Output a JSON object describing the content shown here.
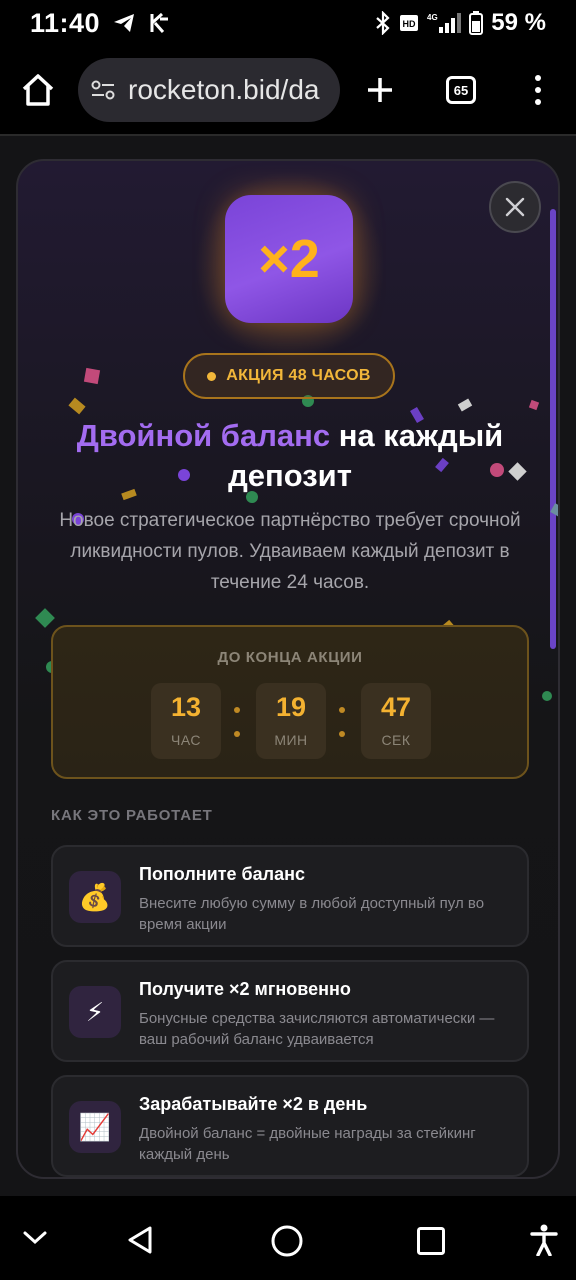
{
  "status_bar": {
    "time": "11:40",
    "battery_percent": "59 %",
    "network": "4G",
    "icons": [
      "telegram-icon",
      "kuna-icon",
      "bluetooth-icon",
      "hd-icon",
      "signal-icon",
      "battery-icon"
    ]
  },
  "browser": {
    "url": "rocketon.bid/da",
    "tab_count": "65",
    "icons": [
      "home-icon",
      "site-settings-icon",
      "new-tab-icon",
      "tabs-icon",
      "more-menu-icon"
    ]
  },
  "modal": {
    "badge_text": "×2",
    "promo_label": "АКЦИЯ 48 ЧАСОВ",
    "headline_accent": "Двойной баланс",
    "headline_rest": " на каждый депозит",
    "subtext": "Новое стратегическое партнёрство требует срочной ликвидности пулов. Удваиваем каждый депозит в течение 24 часов.",
    "countdown": {
      "title": "ДО КОНЦА АКЦИИ",
      "hours": "13",
      "hours_label": "ЧАС",
      "minutes": "19",
      "minutes_label": "МИН",
      "seconds": "47",
      "seconds_label": "СЕК"
    },
    "how_title": "КАК ЭТО РАБОТАЕТ",
    "steps": [
      {
        "icon": "💰",
        "icon_name": "money-bag-icon",
        "title": "Пополните баланс",
        "desc": "Внесите любую сумму в любой доступный пул во время акции"
      },
      {
        "icon": "⚡",
        "icon_name": "lightning-icon",
        "title": "Получите ×2 мгновенно",
        "desc": "Бонусные средства зачисляются автоматически — ваш рабочий баланс удваивается"
      },
      {
        "icon": "📈",
        "icon_name": "chart-up-icon",
        "title": "Зарабатывайте ×2 в день",
        "desc": "Двойной баланс = двойные награды за стейкинг каждый день"
      }
    ]
  },
  "colors": {
    "accent_purple": "#a36cf0",
    "accent_gold": "#f4b231",
    "badge_purple": "#8f56e6"
  },
  "nav_bar": {
    "icons": [
      "chevron-down-icon",
      "back-icon",
      "home-circle-icon",
      "recents-icon",
      "accessibility-icon"
    ]
  }
}
